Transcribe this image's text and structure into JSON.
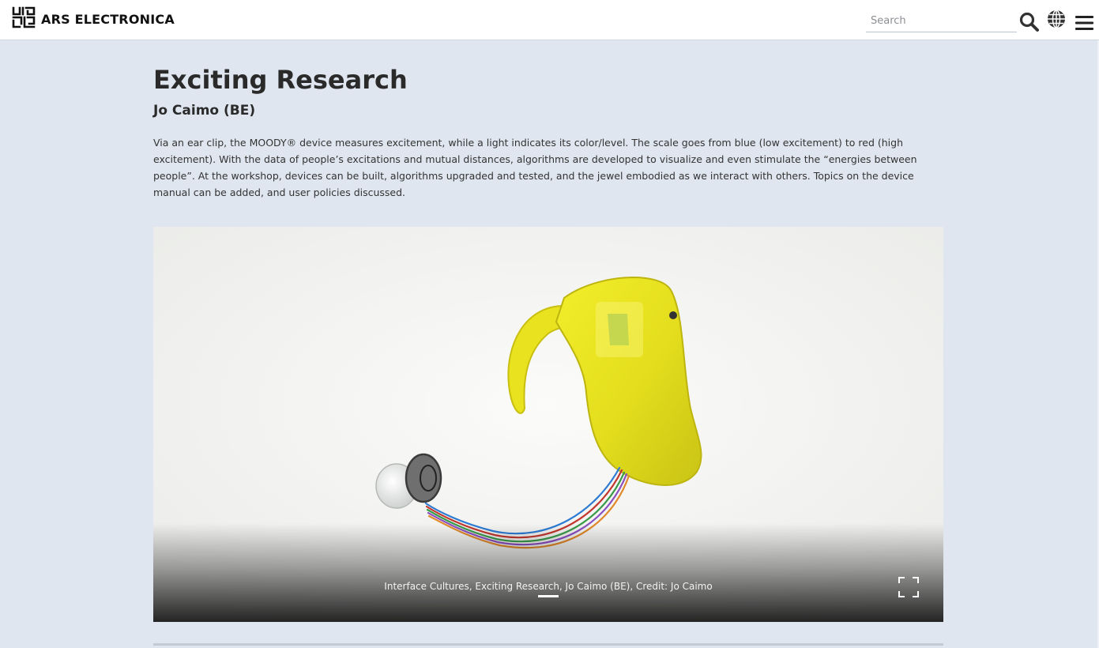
{
  "header": {
    "brand_name": "ARS ELECTRONICA",
    "logo_icon": "ars-electronica-logo-icon",
    "search": {
      "placeholder": "Search",
      "value": ""
    },
    "icons": [
      "search-icon",
      "globe-icon",
      "menu-icon"
    ]
  },
  "article": {
    "title": "Exciting Research",
    "artist": "Jo Caimo (BE)",
    "description": "Via an ear clip, the MOODY® device measures excitement, while a light indicates its color/level. The scale goes from blue (low excitement) to red (high excitement). With the data of people’s excitations and mutual distances, algorithms are developed to visualize and even stimulate the “energies between people”. At the workshop, devices can be built, algorithms upgraded and tested, and the jewel embodied as we interact with others. Topics on the device manual can be added, and user policies discussed."
  },
  "gallery": {
    "caption": "Interface Cultures, Exciting Research, Jo Caimo (BE), Credit: Jo Caimo",
    "slide_index": 1,
    "slide_count": 1,
    "fullscreen_icon": "fullscreen-icon"
  },
  "colors": {
    "page_background": "#dfe6ef",
    "header_background": "#ffffff",
    "text_dark": "#2a2a2a",
    "device_yellow": "#e6e21c"
  }
}
